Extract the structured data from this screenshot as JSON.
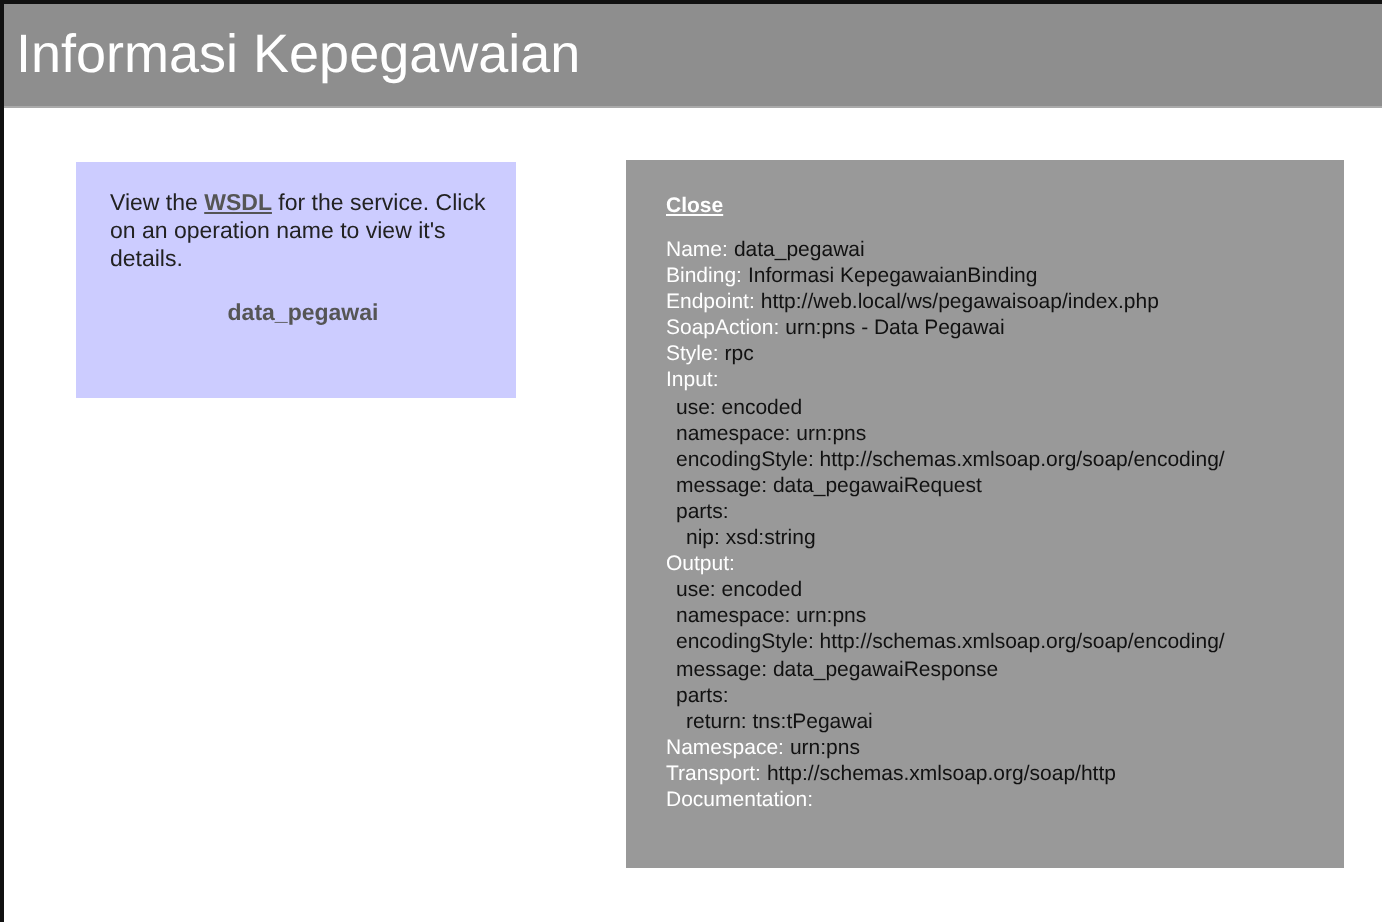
{
  "page_title": "Informasi Kepegawaian",
  "info_box": {
    "text_before": "View the",
    "wsdl_link": "WSDL",
    "text_after": "for the service. Click on an operation name to view it's details.",
    "operations": [
      "data_pegawai"
    ]
  },
  "details": {
    "close": "Close",
    "fields": [
      {
        "label": "Name:",
        "value": "data_pegawai"
      },
      {
        "label": "Binding:",
        "value": "Informasi KepegawaianBinding"
      },
      {
        "label": "Endpoint:",
        "value": "http://web.local/ws/pegawaisoap/index.php"
      },
      {
        "label": "SoapAction:",
        "value": "urn:pns - Data Pegawai"
      },
      {
        "label": "Style:",
        "value": "rpc"
      },
      {
        "label": "Input:",
        "children": [
          {
            "text": "use: encoded"
          },
          {
            "text": "namespace: urn:pns"
          },
          {
            "text": "encodingStyle: http://schemas.xmlsoap.org/soap/encoding/"
          },
          {
            "text": "message: data_pegawaiRequest"
          },
          {
            "text": "parts:",
            "children": [
              {
                "text": "nip: xsd:string"
              }
            ]
          }
        ]
      },
      {
        "label": "Output:",
        "children": [
          {
            "text": "use: encoded"
          },
          {
            "text": "namespace: urn:pns"
          },
          {
            "text": "encodingStyle: http://schemas.xmlsoap.org/soap/encoding/"
          },
          {
            "text": "message: data_pegawaiResponse"
          },
          {
            "text": "parts:",
            "children": [
              {
                "text": "return: tns:tPegawai"
              }
            ]
          }
        ]
      },
      {
        "label": "Namespace:",
        "value": "urn:pns"
      },
      {
        "label": "Transport:",
        "value": "http://schemas.xmlsoap.org/soap/http"
      },
      {
        "label": "Documentation:"
      }
    ]
  }
}
